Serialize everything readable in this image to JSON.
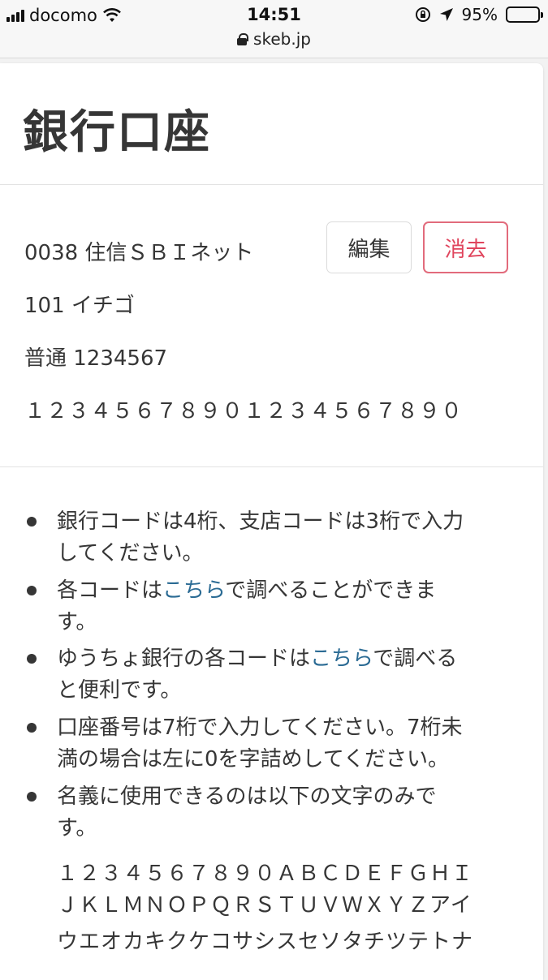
{
  "status_bar": {
    "carrier": "docomo",
    "time": "14:51",
    "battery": "95%",
    "battery_level": 0.95,
    "url": "skeb.jp",
    "icons": [
      "signal-icon",
      "wifi-icon",
      "rotation-lock-icon",
      "location-arrow-icon",
      "battery-icon",
      "lock-icon"
    ]
  },
  "page": {
    "title": "銀行口座"
  },
  "account": {
    "bank": "0038 住信ＳＢＩネット",
    "branch": "101 イチゴ",
    "number": "普通 1234567",
    "holder": "１２３４５６７８９０１２３４５６７８９０",
    "edit_label": "編集",
    "delete_label": "消去"
  },
  "notes": [
    {
      "lines": [
        "銀行コードは4桁、支店コードは3桁で入力",
        "してください。"
      ]
    },
    {
      "pre": "各コードは",
      "link": "こちら",
      "post": "で調べることができま",
      "line2": "す。"
    },
    {
      "pre": "ゆうちょ銀行の各コードは",
      "link": "こちら",
      "post": "で調べる",
      "line2": "と便利です。"
    },
    {
      "lines": [
        "口座番号は7桁で入力してください。7桁未",
        "満の場合は左に0を字詰めしてください。"
      ]
    },
    {
      "lines": [
        "名義に使用できるのは以下の文字のみで",
        "す。"
      ]
    }
  ],
  "allowed_chars": [
    "１２３４５６７８９０ＡＢＣＤＥＦＧＨＩ",
    "ＪＫＬＭＮＯＰＱＲＳＴＵＶＷＸＹＺアイ",
    "ウエオカキクケコサシスセソタチツテトナ"
  ],
  "colors": {
    "delete": "#e0455d",
    "link": "#2b6b94",
    "text": "#363636"
  }
}
